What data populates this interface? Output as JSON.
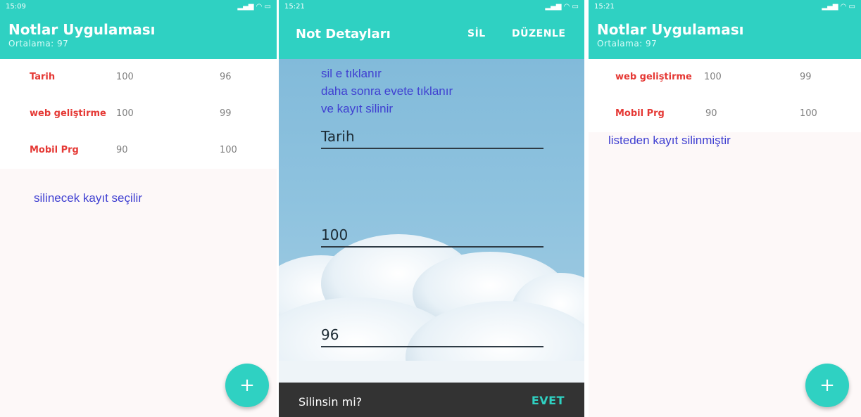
{
  "screen1": {
    "status_time": "15:09",
    "app_title": "Notlar Uygulaması",
    "subtitle": "Ortalama: 97",
    "rows": [
      {
        "name": "Tarih",
        "v1": "100",
        "v2": "96"
      },
      {
        "name": "web geliştirme",
        "v1": "100",
        "v2": "99"
      },
      {
        "name": "Mobil Prg",
        "v1": "90",
        "v2": "100"
      }
    ],
    "annotation": "silinecek kayıt seçilir",
    "fab_label": "+"
  },
  "screen2": {
    "status_time": "15:21",
    "title": "Not Detayları",
    "delete_label": "SİL",
    "edit_label": "DÜZENLE",
    "annotation_lines": [
      "sil e tıklanır",
      "daha sonra evete tıklanır",
      "ve kayıt silinir"
    ],
    "fields": {
      "name": "Tarih",
      "v1": "100",
      "v2": "96"
    },
    "snackbar": {
      "message": "Silinsin mi?",
      "action": "EVET"
    }
  },
  "screen3": {
    "status_time": "15:21",
    "app_title": "Notlar Uygulaması",
    "subtitle": "Ortalama: 97",
    "rows": [
      {
        "name": "web geliştirme",
        "v1": "100",
        "v2": "99"
      },
      {
        "name": "Mobil Prg",
        "v1": "90",
        "v2": "100"
      }
    ],
    "annotation": "listeden kayıt silinmiştir",
    "fab_label": "+"
  },
  "colors": {
    "accent": "#2fd1c2",
    "item_name": "#e53935",
    "annotation": "#3f3fd1",
    "snackbar": "#333333"
  }
}
